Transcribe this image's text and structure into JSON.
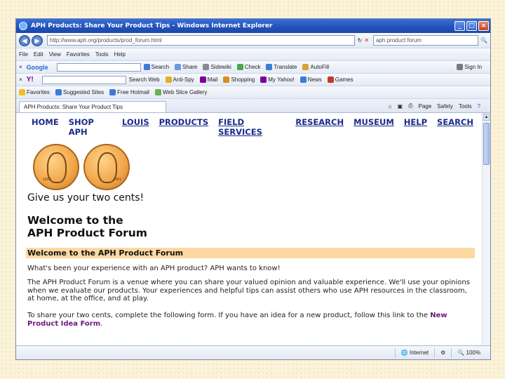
{
  "window": {
    "title": "APH Products: Share Your Product Tips - Windows Internet Explorer",
    "address": "http://www.aph.org/products/prod_forum.html",
    "search_text": "aph product forum"
  },
  "menu": [
    "File",
    "Edit",
    "View",
    "Favorites",
    "Tools",
    "Help"
  ],
  "google_toolbar": {
    "label": "Google",
    "items": [
      "Search",
      "Share",
      "Sidewiki",
      "Check",
      "Translate",
      "AutoFill",
      "Sign In"
    ]
  },
  "yahoo_toolbar": {
    "label": "Y!",
    "items": [
      "Search Web",
      "Anti-Spy",
      "Mail",
      "Shopping",
      "My Yahoo!",
      "News",
      "Games"
    ]
  },
  "favorites_bar": {
    "items": [
      "Favorites",
      "Suggested Sites",
      "Free Hotmail",
      "Web Slice Gallery"
    ]
  },
  "tab": {
    "label": "APH Products: Share Your Product Tips"
  },
  "command_bar": [
    "Page",
    "Safety",
    "Tools"
  ],
  "site_nav": [
    "HOME",
    "SHOP APH",
    "LOUIS",
    "PRODUCTS",
    "FIELD SERVICES",
    "RESEARCH",
    "MUSEUM",
    "HELP",
    "SEARCH"
  ],
  "page": {
    "coin_years": [
      "1933",
      "2001"
    ],
    "two_cents": "Give us your two cents!",
    "welcome_line1": "Welcome to the",
    "welcome_line2": "APH Product Forum",
    "band_heading": "Welcome to the APH Product Forum",
    "p1": "What's been your experience with an APH product? APH wants to know!",
    "p2": "The APH Product Forum is a venue where you can share your valued opinion and valuable experience. We'll use your opinions when we evaluate our products. Your experiences and helpful tips can assist others who use APH resources in the classroom, at home, at the office, and at play.",
    "p3_text": "To share your two cents, complete the following form. If you have an idea for a new product, follow this link to the",
    "p3_link": "New Product Idea Form",
    "p3_end": "."
  },
  "status": {
    "zone": "Internet",
    "zoom": "100%"
  }
}
